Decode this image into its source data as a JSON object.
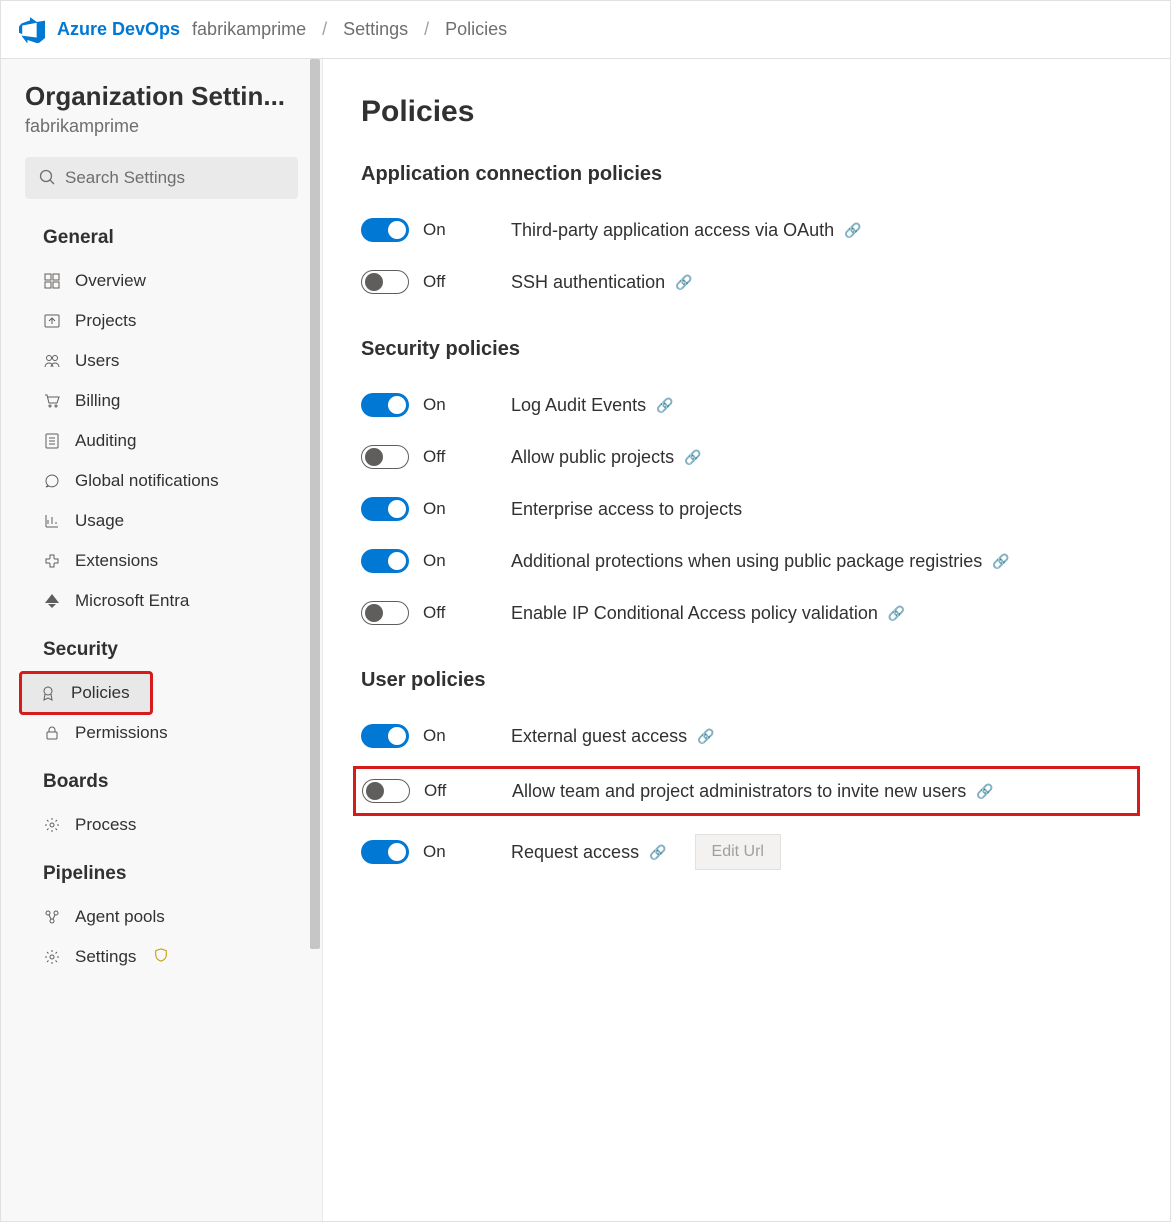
{
  "header": {
    "brand": "Azure DevOps",
    "org": "fabrikamprime",
    "crumb_settings": "Settings",
    "crumb_policies": "Policies"
  },
  "sidebar": {
    "title": "Organization Settin...",
    "subtitle": "fabrikamprime",
    "search_placeholder": "Search Settings",
    "groups": {
      "general": {
        "title": "General",
        "overview": "Overview",
        "projects": "Projects",
        "users": "Users",
        "billing": "Billing",
        "auditing": "Auditing",
        "global_notifications": "Global notifications",
        "usage": "Usage",
        "extensions": "Extensions",
        "entra": "Microsoft Entra"
      },
      "security": {
        "title": "Security",
        "policies": "Policies",
        "permissions": "Permissions"
      },
      "boards": {
        "title": "Boards",
        "process": "Process"
      },
      "pipelines": {
        "title": "Pipelines",
        "agent_pools": "Agent pools",
        "settings": "Settings"
      }
    }
  },
  "main": {
    "title": "Policies",
    "labels": {
      "on": "On",
      "off": "Off",
      "edit_url": "Edit Url"
    },
    "sections": {
      "app": {
        "title": "Application connection policies",
        "oauth": "Third-party application access via OAuth",
        "ssh": "SSH authentication"
      },
      "security": {
        "title": "Security policies",
        "audit": "Log Audit Events",
        "public": "Allow public projects",
        "enterprise": "Enterprise access to projects",
        "registries": "Additional protections when using public package registries",
        "ip": "Enable IP Conditional Access policy validation"
      },
      "user": {
        "title": "User policies",
        "guest": "External guest access",
        "invite": "Allow team and project administrators to invite new users",
        "request": "Request access"
      }
    }
  }
}
